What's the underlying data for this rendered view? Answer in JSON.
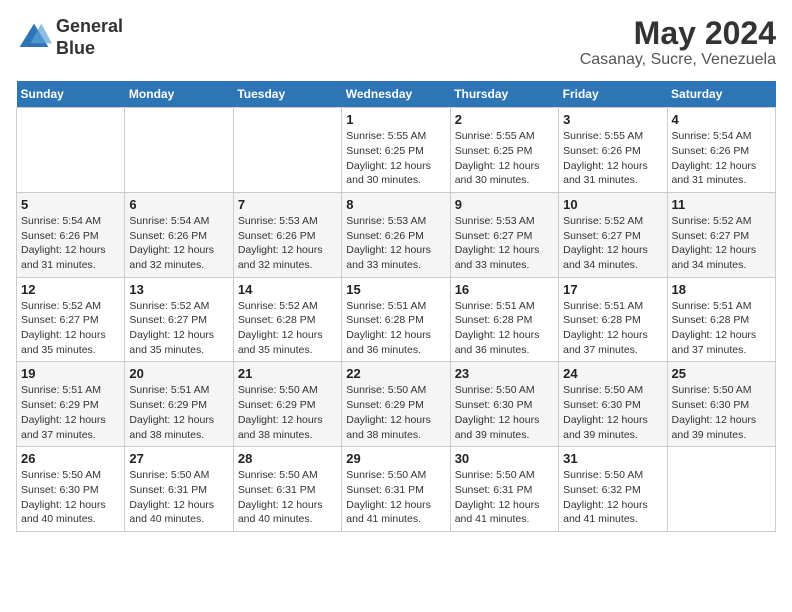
{
  "header": {
    "logo_line1": "General",
    "logo_line2": "Blue",
    "month_title": "May 2024",
    "location": "Casanay, Sucre, Venezuela"
  },
  "days_of_week": [
    "Sunday",
    "Monday",
    "Tuesday",
    "Wednesday",
    "Thursday",
    "Friday",
    "Saturday"
  ],
  "weeks": [
    [
      {
        "day": "",
        "info": ""
      },
      {
        "day": "",
        "info": ""
      },
      {
        "day": "",
        "info": ""
      },
      {
        "day": "1",
        "info": "Sunrise: 5:55 AM\nSunset: 6:25 PM\nDaylight: 12 hours\nand 30 minutes."
      },
      {
        "day": "2",
        "info": "Sunrise: 5:55 AM\nSunset: 6:25 PM\nDaylight: 12 hours\nand 30 minutes."
      },
      {
        "day": "3",
        "info": "Sunrise: 5:55 AM\nSunset: 6:26 PM\nDaylight: 12 hours\nand 31 minutes."
      },
      {
        "day": "4",
        "info": "Sunrise: 5:54 AM\nSunset: 6:26 PM\nDaylight: 12 hours\nand 31 minutes."
      }
    ],
    [
      {
        "day": "5",
        "info": "Sunrise: 5:54 AM\nSunset: 6:26 PM\nDaylight: 12 hours\nand 31 minutes."
      },
      {
        "day": "6",
        "info": "Sunrise: 5:54 AM\nSunset: 6:26 PM\nDaylight: 12 hours\nand 32 minutes."
      },
      {
        "day": "7",
        "info": "Sunrise: 5:53 AM\nSunset: 6:26 PM\nDaylight: 12 hours\nand 32 minutes."
      },
      {
        "day": "8",
        "info": "Sunrise: 5:53 AM\nSunset: 6:26 PM\nDaylight: 12 hours\nand 33 minutes."
      },
      {
        "day": "9",
        "info": "Sunrise: 5:53 AM\nSunset: 6:27 PM\nDaylight: 12 hours\nand 33 minutes."
      },
      {
        "day": "10",
        "info": "Sunrise: 5:52 AM\nSunset: 6:27 PM\nDaylight: 12 hours\nand 34 minutes."
      },
      {
        "day": "11",
        "info": "Sunrise: 5:52 AM\nSunset: 6:27 PM\nDaylight: 12 hours\nand 34 minutes."
      }
    ],
    [
      {
        "day": "12",
        "info": "Sunrise: 5:52 AM\nSunset: 6:27 PM\nDaylight: 12 hours\nand 35 minutes."
      },
      {
        "day": "13",
        "info": "Sunrise: 5:52 AM\nSunset: 6:27 PM\nDaylight: 12 hours\nand 35 minutes."
      },
      {
        "day": "14",
        "info": "Sunrise: 5:52 AM\nSunset: 6:28 PM\nDaylight: 12 hours\nand 35 minutes."
      },
      {
        "day": "15",
        "info": "Sunrise: 5:51 AM\nSunset: 6:28 PM\nDaylight: 12 hours\nand 36 minutes."
      },
      {
        "day": "16",
        "info": "Sunrise: 5:51 AM\nSunset: 6:28 PM\nDaylight: 12 hours\nand 36 minutes."
      },
      {
        "day": "17",
        "info": "Sunrise: 5:51 AM\nSunset: 6:28 PM\nDaylight: 12 hours\nand 37 minutes."
      },
      {
        "day": "18",
        "info": "Sunrise: 5:51 AM\nSunset: 6:28 PM\nDaylight: 12 hours\nand 37 minutes."
      }
    ],
    [
      {
        "day": "19",
        "info": "Sunrise: 5:51 AM\nSunset: 6:29 PM\nDaylight: 12 hours\nand 37 minutes."
      },
      {
        "day": "20",
        "info": "Sunrise: 5:51 AM\nSunset: 6:29 PM\nDaylight: 12 hours\nand 38 minutes."
      },
      {
        "day": "21",
        "info": "Sunrise: 5:50 AM\nSunset: 6:29 PM\nDaylight: 12 hours\nand 38 minutes."
      },
      {
        "day": "22",
        "info": "Sunrise: 5:50 AM\nSunset: 6:29 PM\nDaylight: 12 hours\nand 38 minutes."
      },
      {
        "day": "23",
        "info": "Sunrise: 5:50 AM\nSunset: 6:30 PM\nDaylight: 12 hours\nand 39 minutes."
      },
      {
        "day": "24",
        "info": "Sunrise: 5:50 AM\nSunset: 6:30 PM\nDaylight: 12 hours\nand 39 minutes."
      },
      {
        "day": "25",
        "info": "Sunrise: 5:50 AM\nSunset: 6:30 PM\nDaylight: 12 hours\nand 39 minutes."
      }
    ],
    [
      {
        "day": "26",
        "info": "Sunrise: 5:50 AM\nSunset: 6:30 PM\nDaylight: 12 hours\nand 40 minutes."
      },
      {
        "day": "27",
        "info": "Sunrise: 5:50 AM\nSunset: 6:31 PM\nDaylight: 12 hours\nand 40 minutes."
      },
      {
        "day": "28",
        "info": "Sunrise: 5:50 AM\nSunset: 6:31 PM\nDaylight: 12 hours\nand 40 minutes."
      },
      {
        "day": "29",
        "info": "Sunrise: 5:50 AM\nSunset: 6:31 PM\nDaylight: 12 hours\nand 41 minutes."
      },
      {
        "day": "30",
        "info": "Sunrise: 5:50 AM\nSunset: 6:31 PM\nDaylight: 12 hours\nand 41 minutes."
      },
      {
        "day": "31",
        "info": "Sunrise: 5:50 AM\nSunset: 6:32 PM\nDaylight: 12 hours\nand 41 minutes."
      },
      {
        "day": "",
        "info": ""
      }
    ]
  ]
}
